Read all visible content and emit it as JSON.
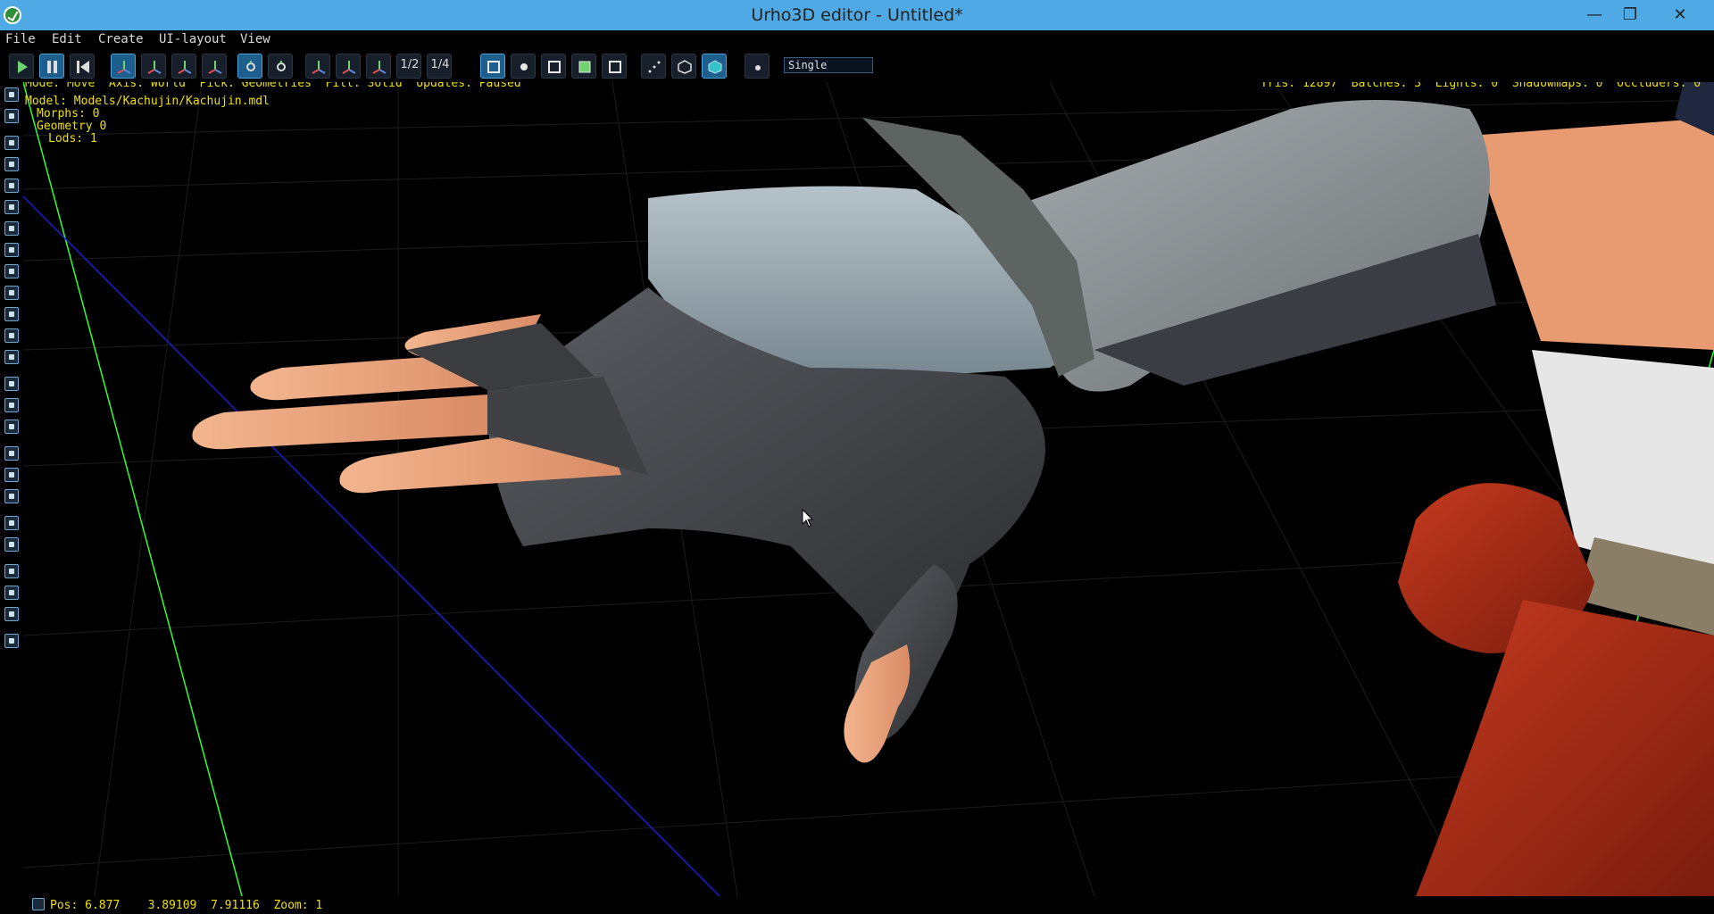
{
  "window": {
    "title": "Urho3D editor - Untitled*",
    "minimize_glyph": "—",
    "maximize_glyph": "❐",
    "close_glyph": "✕"
  },
  "menu": [
    "File",
    "Edit",
    "Create",
    "UI-layout",
    "View"
  ],
  "toolbar": {
    "snap_fractions": [
      "1/2",
      "1/4"
    ],
    "view_mode_select": "Single"
  },
  "overlay": {
    "mode_line": "Mode: Move  Axis: World  Pick: Geometries  Fill: Solid  Updates: Paused",
    "stats_line": "Tris: 12897  Batches: 3  Lights: 0  Shadowmaps: 0  Occluders: 0",
    "model": "Model: Models/Kachujin/Kachujin.mdl",
    "morphs": "Morphs: 0",
    "geometry": "Geometry 0",
    "lods": "Lods: 1"
  },
  "status": {
    "text": "Pos: 6.877    3.89109  7.91116  Zoom: 1"
  },
  "colors": {
    "accent": "#4ea9e4",
    "overlay_text": "#f0e000",
    "grid_axis_green": "#32ff32",
    "grid_axis_blue": "#2020ff"
  },
  "icons": [
    "play-icon",
    "pause-icon",
    "restart-icon",
    "move-gizmo-icon",
    "rotate-gizmo-icon",
    "scale-gizmo-icon",
    "select-gizmo-icon",
    "local-axis-icon",
    "world-axis-icon",
    "snap-translate-icon",
    "snap-rotate-icon",
    "snap-scale-icon",
    "pick-geometries-icon",
    "pick-lights-icon",
    "pick-zones-icon",
    "pick-rigidbodies-icon",
    "pick-ui-icon",
    "fill-points-icon",
    "fill-wireframe-icon",
    "fill-solid-icon",
    "camera-icon"
  ]
}
